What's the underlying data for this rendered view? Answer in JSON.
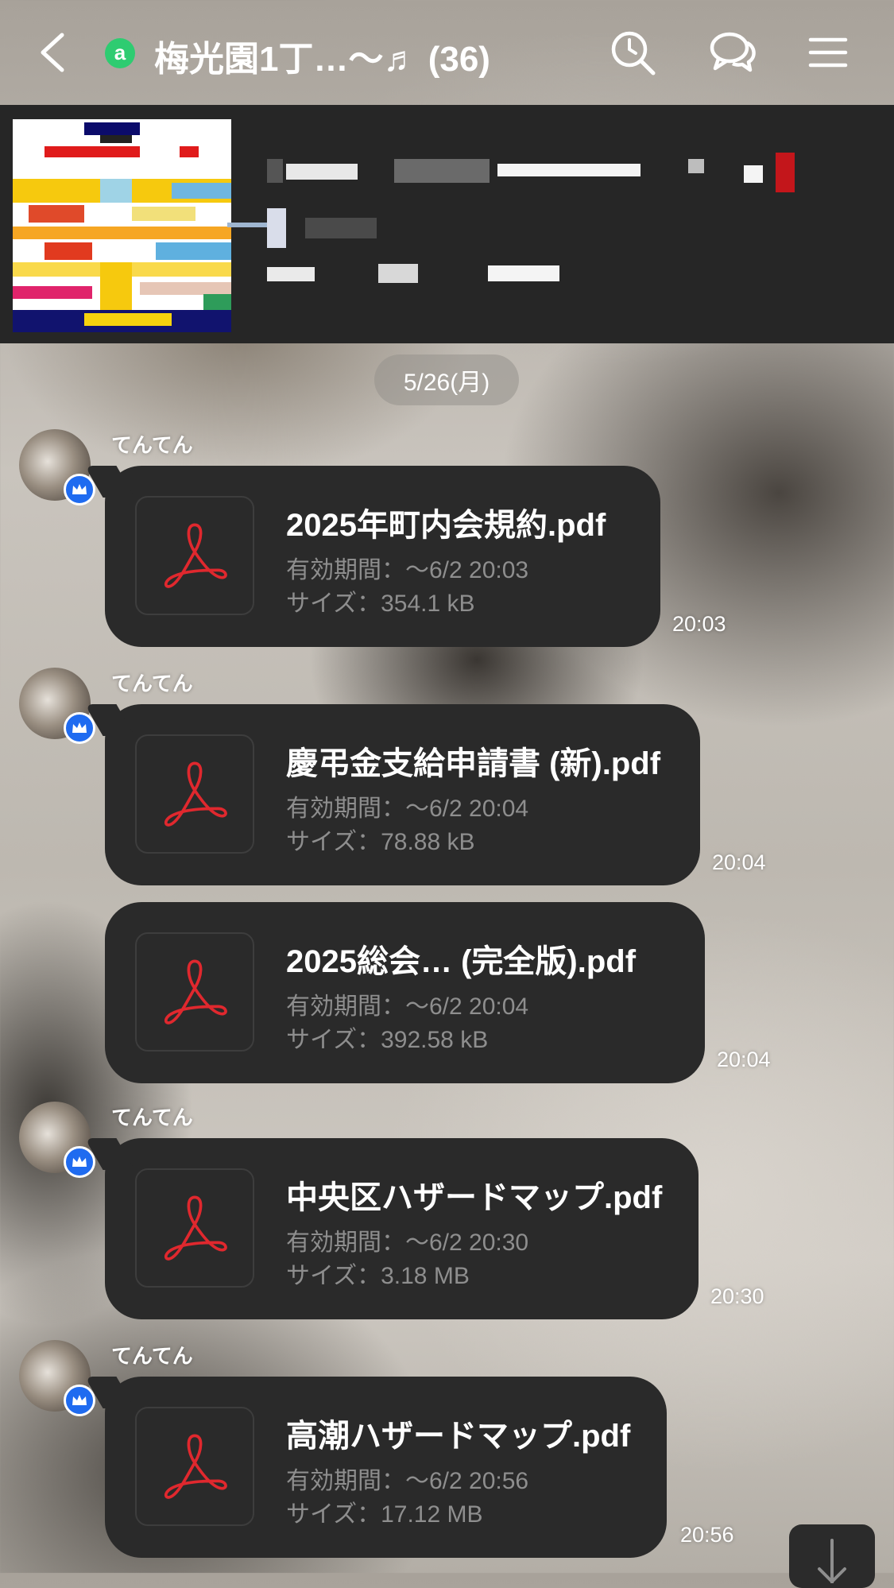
{
  "header": {
    "title": "梅光園1丁…〜♬ (36)",
    "badge_letter": "a",
    "icons": [
      "back-icon",
      "history-search-icon",
      "chat-bubbles-icon",
      "menu-icon"
    ]
  },
  "colors": {
    "header_text": "#ffffff",
    "pinned_bg": "#262626",
    "bubble_bg": "#2a2a2a",
    "official_badge": "#2ecc71",
    "crown_badge": "#1f6bf0",
    "pdf_icon": "#e0282e",
    "secondary_text": "#8e8e8e"
  },
  "date_separator": "5/26(月)",
  "messages": [
    {
      "sender": "てんてん",
      "file_name": "2025年町内会規約.pdf",
      "expiry": "有効期間：〜6/2 20:03",
      "size": "サイズ：354.1 kB",
      "time": "20:03"
    },
    {
      "sender": "てんてん",
      "file_name": "慶弔金支給申請書 (新).pdf",
      "expiry": "有効期間：〜6/2 20:04",
      "size": "サイズ：78.88 kB",
      "time": "20:04"
    },
    {
      "sender": "",
      "file_name": "2025総会… (完全版).pdf",
      "expiry": "有効期間：〜6/2 20:04",
      "size": "サイズ：392.58 kB",
      "time": "20:04"
    },
    {
      "sender": "てんてん",
      "file_name": "中央区ハザードマップ.pdf",
      "expiry": "有効期間：〜6/2 20:30",
      "size": "サイズ：3.18 MB",
      "time": "20:30"
    },
    {
      "sender": "てんてん",
      "file_name": "高潮ハザードマップ.pdf",
      "expiry": "有効期間：〜6/2 20:56",
      "size": "サイズ：17.12 MB",
      "time": "20:56"
    }
  ]
}
